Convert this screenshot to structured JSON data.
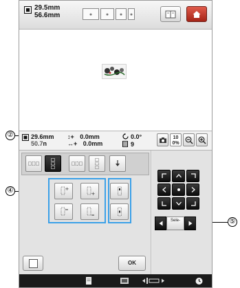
{
  "topbar": {
    "size_width": "29.5mm",
    "size_height": "56.6mm",
    "accent_home": "#c23a2b"
  },
  "info": {
    "width": "29.6mm",
    "height_partial": "50.7",
    "height_suffix": "n",
    "vert_label": "↕+",
    "vert_value": "0.0mm",
    "horiz_label": "↔+",
    "horiz_value": "0.0mm",
    "angle": "0.0°",
    "colors": "9",
    "zoom": "100%"
  },
  "move_keys": {
    "select_label": "Sele-"
  },
  "buttons": {
    "ok_label": "OK"
  },
  "callouts": {
    "tabs": "②",
    "align_group": "④",
    "center_group": "⑤"
  },
  "colors": {
    "group_border": "#3aa0e8",
    "key_dark": "#161616"
  }
}
